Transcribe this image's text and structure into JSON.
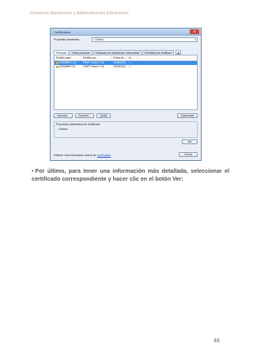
{
  "header": {
    "title": "Comercio Electrónico y Administración Electrónica"
  },
  "dialog": {
    "title": "Certificados",
    "close_icon": "close-icon",
    "purpose_label": "Propósito planteado:",
    "purpose_value": "<Todos>",
    "tabs": [
      "Personal",
      "Otras personas",
      "Entidades de certificación intermedias",
      "Entidades de certificaci"
    ],
    "tab_nav": "◂▸",
    "columns": [
      "Emitido para",
      "Emitido por",
      "Fecha de...",
      "N..."
    ],
    "rows": [
      {
        "issued_to": "NOMBRE LUI...",
        "issued_by": "FNMT Clase 2 CA",
        "date": "14/03/2014",
        "name": "<..."
      },
      {
        "issued_to": "NOMBRE RU...",
        "issued_by": "FNMT Clase 2 CA",
        "date": "10/03/2014",
        "name": "<..."
      }
    ],
    "buttons": {
      "import": "Importar...",
      "export": "Exportar...",
      "remove": "Quitar",
      "advanced": "Avanzadas",
      "view": "Ver",
      "close": "Cerrar"
    },
    "purposes_legend": "Propósitos planteados del certificado",
    "purposes_value": "<Todos>",
    "footer_text": "Obtener más información acerca de ",
    "footer_link": "certificados"
  },
  "paragraph": {
    "bullet": "•",
    "text": "Por último, para tener una información más detallada, seleccionar el certificado correspondiente y hacer clic en el botón Ver:"
  },
  "page_number": "48"
}
